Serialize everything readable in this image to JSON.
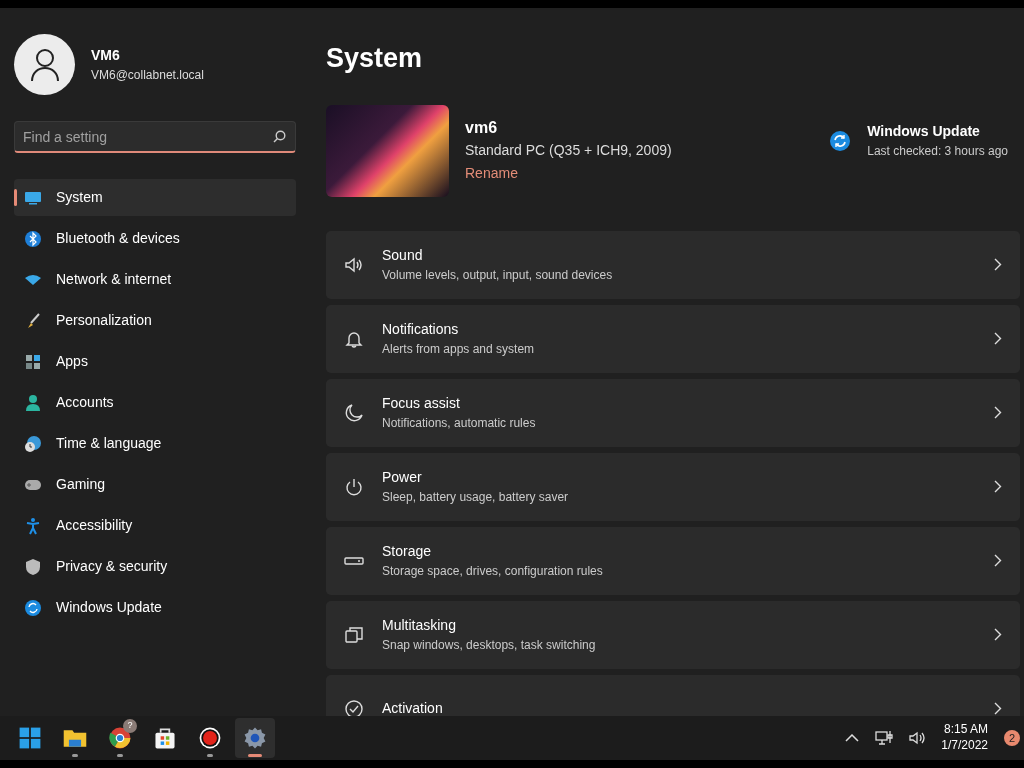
{
  "account": {
    "name": "VM6",
    "email": "VM6@collabnet.local"
  },
  "search": {
    "placeholder": "Find a setting"
  },
  "sidebar": {
    "items": [
      {
        "label": "System",
        "selected": true
      },
      {
        "label": "Bluetooth & devices",
        "selected": false
      },
      {
        "label": "Network & internet",
        "selected": false
      },
      {
        "label": "Personalization",
        "selected": false
      },
      {
        "label": "Apps",
        "selected": false
      },
      {
        "label": "Accounts",
        "selected": false
      },
      {
        "label": "Time & language",
        "selected": false
      },
      {
        "label": "Gaming",
        "selected": false
      },
      {
        "label": "Accessibility",
        "selected": false
      },
      {
        "label": "Privacy & security",
        "selected": false
      },
      {
        "label": "Windows Update",
        "selected": false
      }
    ]
  },
  "page": {
    "title": "System"
  },
  "device": {
    "name": "vm6",
    "model": "Standard PC (Q35 + ICH9, 2009)",
    "rename": "Rename"
  },
  "update": {
    "title": "Windows Update",
    "status": "Last checked: 3 hours ago"
  },
  "settings": [
    {
      "title": "Sound",
      "subtitle": "Volume levels, output, input, sound devices"
    },
    {
      "title": "Notifications",
      "subtitle": "Alerts from apps and system"
    },
    {
      "title": "Focus assist",
      "subtitle": "Notifications, automatic rules"
    },
    {
      "title": "Power",
      "subtitle": "Sleep, battery usage, battery saver"
    },
    {
      "title": "Storage",
      "subtitle": "Storage space, drives, configuration rules"
    },
    {
      "title": "Multitasking",
      "subtitle": "Snap windows, desktops, task switching"
    },
    {
      "title": "Activation"
    }
  ],
  "taskbar": {
    "apps": [
      {
        "running": false,
        "active": false
      },
      {
        "running": true,
        "active": false
      },
      {
        "running": true,
        "active": false,
        "badge": "?"
      },
      {
        "running": false,
        "active": false
      },
      {
        "running": true,
        "active": false
      },
      {
        "running": true,
        "active": true
      }
    ],
    "time": "8:15 AM",
    "date": "1/7/2022",
    "notifications": "2"
  }
}
